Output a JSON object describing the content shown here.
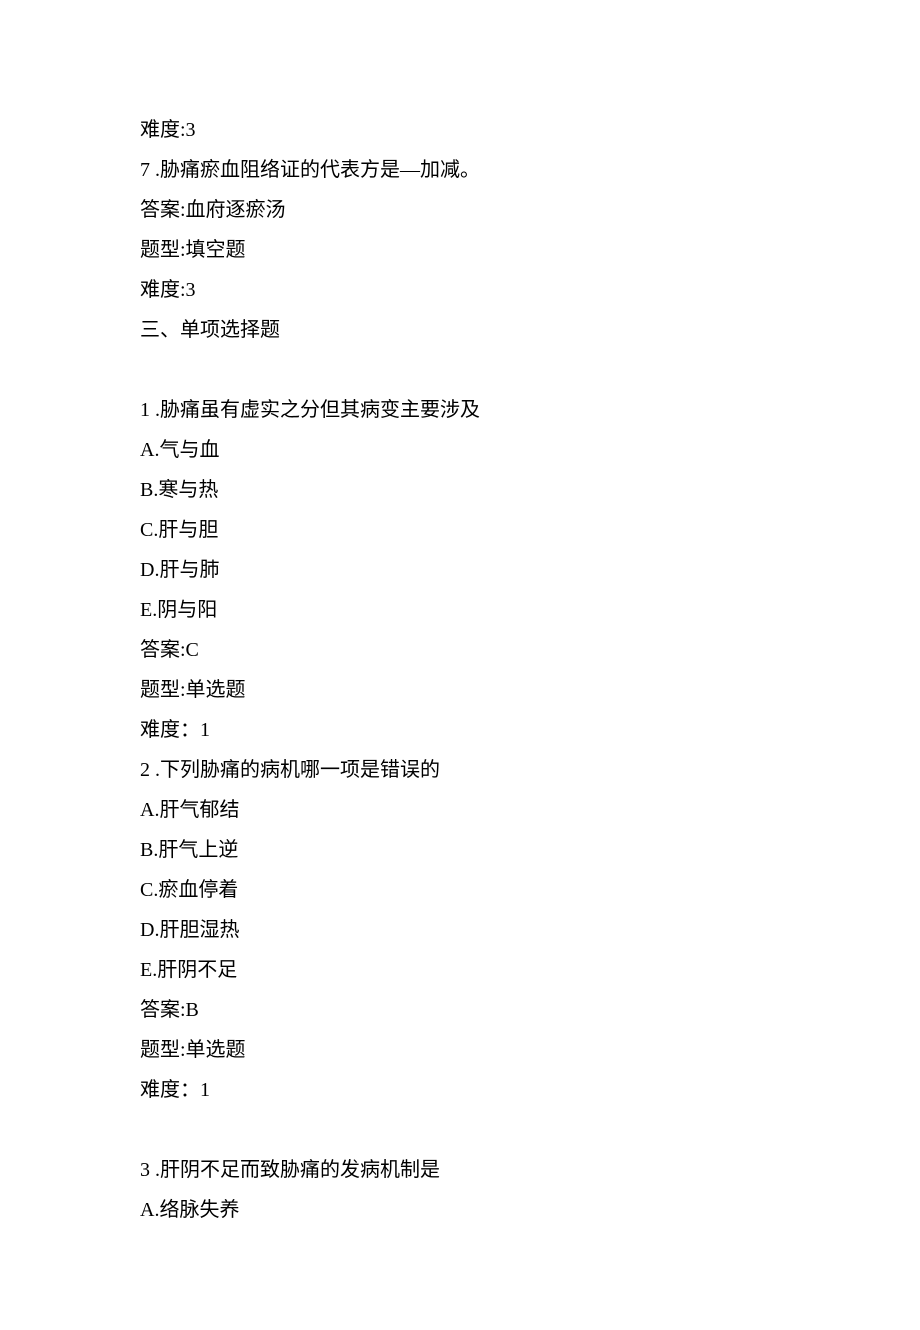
{
  "lines": {
    "l1": "难度:3",
    "l2": "7 .胁痛瘀血阻络证的代表方是—加减。",
    "l3": "答案:血府逐瘀汤",
    "l4": "题型:填空题",
    "l5": "难度:3",
    "l6": "三、单项选择题",
    "l7": "1 .胁痛虽有虚实之分但其病变主要涉及",
    "l8": "A.气与血",
    "l9": "B.寒与热",
    "l10": "C.肝与胆",
    "l11": "D.肝与肺",
    "l12": "E.阴与阳",
    "l13": "答案:C",
    "l14": "题型:单选题",
    "l15": "难度：1",
    "l16": "2 .下列胁痛的病机哪一项是错误的",
    "l17": "A.肝气郁结",
    "l18": "B.肝气上逆",
    "l19": "C.瘀血停着",
    "l20": "D.肝胆湿热",
    "l21": "E.肝阴不足",
    "l22": "答案:B",
    "l23": "题型:单选题",
    "l24": "难度：1",
    "l25": "3 .肝阴不足而致胁痛的发病机制是",
    "l26": "A.络脉失养"
  }
}
